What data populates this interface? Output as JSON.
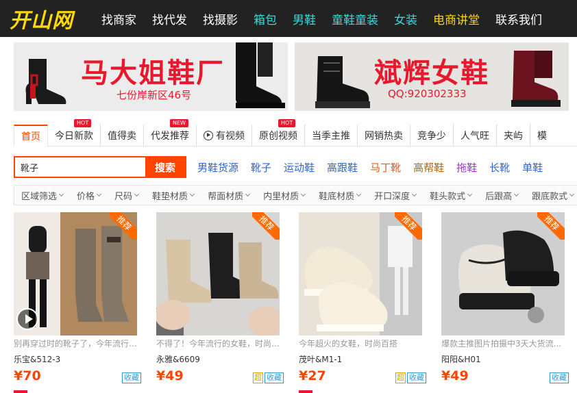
{
  "logo": "开山网",
  "nav": [
    {
      "label": "找商家",
      "color": "white"
    },
    {
      "label": "找代发",
      "color": "white"
    },
    {
      "label": "找摄影",
      "color": "white"
    },
    {
      "label": "箱包",
      "color": "cyan"
    },
    {
      "label": "男鞋",
      "color": "cyan"
    },
    {
      "label": "童鞋童装",
      "color": "cyan"
    },
    {
      "label": "女装",
      "color": "cyan"
    },
    {
      "label": "电商讲堂",
      "color": "yellow"
    },
    {
      "label": "联系我们",
      "color": "white"
    }
  ],
  "banners": {
    "left": {
      "title": "马大姐鞋厂",
      "subtitle": "七份岸新区46号"
    },
    "right": {
      "title": "斌辉女鞋",
      "subtitle": "QQ:920302333"
    }
  },
  "tabs": [
    {
      "label": "首页",
      "active": true,
      "badge": "",
      "icon": ""
    },
    {
      "label": "今日新款",
      "badge": "HOT",
      "icon": ""
    },
    {
      "label": "值得卖",
      "badge": "",
      "icon": ""
    },
    {
      "label": "代发推荐",
      "badge": "NEW",
      "icon": ""
    },
    {
      "label": "有视频",
      "badge": "",
      "icon": "play-circle-icon"
    },
    {
      "label": "原创视频",
      "badge": "HOT",
      "icon": ""
    },
    {
      "label": "当季主推",
      "badge": "",
      "icon": ""
    },
    {
      "label": "网销热卖",
      "badge": "",
      "icon": ""
    },
    {
      "label": "竞争少",
      "badge": "",
      "icon": ""
    },
    {
      "label": "人气旺",
      "badge": "",
      "icon": ""
    },
    {
      "label": "夹屿",
      "badge": "",
      "icon": ""
    },
    {
      "label": "模",
      "badge": "",
      "icon": ""
    }
  ],
  "search": {
    "value": "靴子",
    "button": "搜索"
  },
  "quick_links": [
    {
      "label": "男鞋货源",
      "color": "#3366cc"
    },
    {
      "label": "靴子",
      "color": "#3366cc"
    },
    {
      "label": "运动鞋",
      "color": "#3366cc"
    },
    {
      "label": "高跟鞋",
      "color": "#3366cc"
    },
    {
      "label": "马丁靴",
      "color": "#e05c1a"
    },
    {
      "label": "高帮鞋",
      "color": "#c06000"
    },
    {
      "label": "拖鞋",
      "color": "#9933cc"
    },
    {
      "label": "长靴",
      "color": "#3366cc"
    },
    {
      "label": "单鞋",
      "color": "#3366cc"
    }
  ],
  "filters": [
    "区域筛选",
    "价格",
    "尺码",
    "鞋垫材质",
    "帮面材质",
    "内里材质",
    "鞋底材质",
    "开口深度",
    "鞋头款式",
    "后跟高",
    "跟底款式"
  ],
  "products": [
    {
      "desc": "别再穿过时的靴子了，今年流行...",
      "shop": "乐宝&512-3",
      "price": "¥70",
      "ribbon": "推荐",
      "fav": "收藏",
      "chao": "",
      "video": true
    },
    {
      "desc": "不得了！今年流行的女鞋，时尚...",
      "shop": "永雅&6609",
      "price": "¥49",
      "ribbon": "推荐",
      "fav": "收藏",
      "chao": "超",
      "video": false
    },
    {
      "desc": "今年超火的女鞋，时尚百搭",
      "shop": "茂叶&M1-1",
      "price": "¥27",
      "ribbon": "推荐",
      "fav": "收藏",
      "chao": "超",
      "video": false
    },
    {
      "desc": "爆款主推图片拍摄中3天大货流...",
      "shop": "阳阳&H01",
      "price": "¥49",
      "ribbon": "推荐",
      "fav": "收藏",
      "chao": "",
      "video": false
    }
  ]
}
